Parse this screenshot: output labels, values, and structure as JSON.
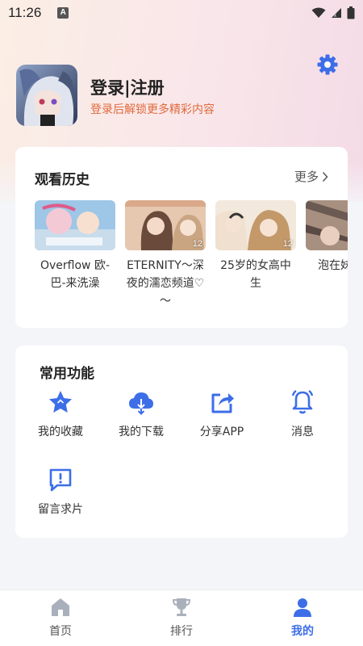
{
  "status_bar": {
    "time": "11:26",
    "a_badge": "A"
  },
  "profile": {
    "title": "登录|注册",
    "subtitle": "登录后解锁更多精彩内容"
  },
  "history": {
    "title": "观看历史",
    "more_label": "更多",
    "items": [
      {
        "title": "Overflow 欧-巴-来洗澡",
        "badge": ""
      },
      {
        "title": "ETERNITY～深夜的濡恋频道♡～",
        "badge": "12"
      },
      {
        "title": "25岁的女高中生",
        "badge": "12"
      },
      {
        "title": "泡在妹问用",
        "badge": ""
      }
    ]
  },
  "functions": {
    "title": "常用功能",
    "items": [
      {
        "label": "我的收藏",
        "icon": "star-icon"
      },
      {
        "label": "我的下载",
        "icon": "cloud-download-icon"
      },
      {
        "label": "分享APP",
        "icon": "share-icon"
      },
      {
        "label": "消息",
        "icon": "bell-icon"
      },
      {
        "label": "留言求片",
        "icon": "message-icon"
      }
    ]
  },
  "bottom_nav": {
    "items": [
      {
        "label": "首页",
        "icon": "home-icon",
        "active": false
      },
      {
        "label": "排行",
        "icon": "trophy-icon",
        "active": false
      },
      {
        "label": "我的",
        "icon": "user-icon",
        "active": true
      }
    ]
  },
  "colors": {
    "accent": "#3d6ee8",
    "subtitle": "#e06a3c"
  }
}
